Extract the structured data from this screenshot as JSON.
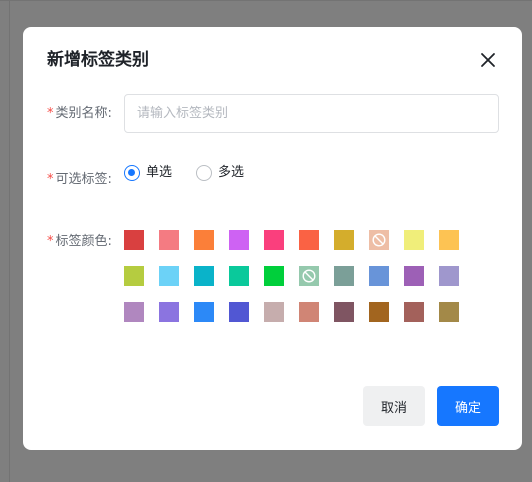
{
  "dialog": {
    "title": "新增标签类别",
    "name_label": "类别名称:",
    "name_placeholder": "请输入标签类别",
    "name_value": "",
    "select_label": "可选标签:",
    "options": [
      {
        "label": "单选",
        "checked": true
      },
      {
        "label": "多选",
        "checked": false
      }
    ],
    "color_label": "标签颜色:",
    "colors": [
      {
        "hex": "#d94040"
      },
      {
        "hex": "#f47b82"
      },
      {
        "hex": "#fb7f39"
      },
      {
        "hex": "#ce62f3"
      },
      {
        "hex": "#fa3f7d"
      },
      {
        "hex": "#fa6244"
      },
      {
        "hex": "#d4ad2c"
      },
      {
        "hex": "#eebea6",
        "icon": "disabled-icon"
      },
      {
        "hex": "#f0ee7a"
      },
      {
        "hex": "#fdc353"
      },
      {
        "hex": "#b5cc40"
      },
      {
        "hex": "#6cd2f7"
      },
      {
        "hex": "#0ab3c9"
      },
      {
        "hex": "#0ac99b"
      },
      {
        "hex": "#00cf3b"
      },
      {
        "hex": "#95c9ad",
        "icon": "disabled-icon"
      },
      {
        "hex": "#7b9f98"
      },
      {
        "hex": "#6894d9"
      },
      {
        "hex": "#9d60b6"
      },
      {
        "hex": "#9f97cd"
      },
      {
        "hex": "#b087bf"
      },
      {
        "hex": "#8b74e0"
      },
      {
        "hex": "#2c89f7"
      },
      {
        "hex": "#5157d3"
      },
      {
        "hex": "#c6adad"
      },
      {
        "hex": "#d08575"
      },
      {
        "hex": "#7f5562"
      },
      {
        "hex": "#a2651f"
      },
      {
        "hex": "#a3615b"
      },
      {
        "hex": "#a38948"
      }
    ],
    "cancel_label": "取消",
    "ok_label": "确定"
  },
  "theme": {
    "accent": "#1677ff",
    "required": "#f54a45"
  }
}
